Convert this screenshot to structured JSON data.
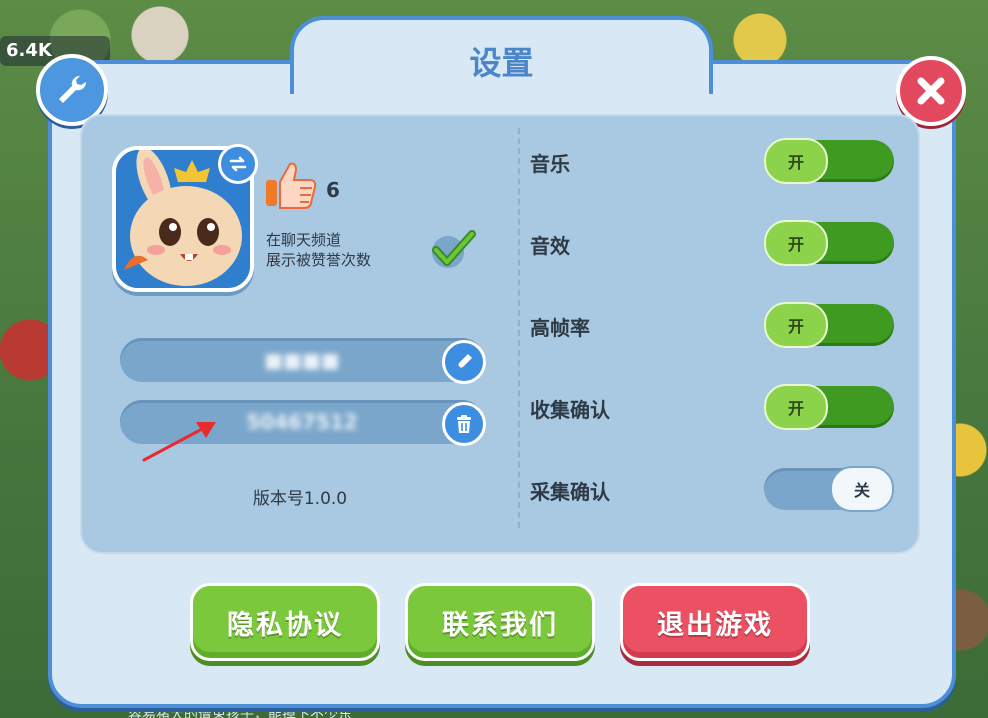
{
  "background": {
    "stat_badge": "6.4K",
    "bottom_text": "容易猪大的遭束孩子，能掉下不少东"
  },
  "dialog": {
    "title": "设置"
  },
  "profile": {
    "likes": "6",
    "chat_display_line1": "在聊天频道",
    "chat_display_line2": "展示被赞誉次数",
    "chat_display_enabled": true,
    "name_value": "■■■■",
    "id_value": "50467512",
    "version": "版本号1.0.0"
  },
  "settings": [
    {
      "label": "音乐",
      "state": "开",
      "on": true
    },
    {
      "label": "音效",
      "state": "开",
      "on": true
    },
    {
      "label": "高帧率",
      "state": "开",
      "on": true
    },
    {
      "label": "收集确认",
      "state": "开",
      "on": true
    },
    {
      "label": "采集确认",
      "state": "关",
      "on": false
    }
  ],
  "buttons": {
    "privacy": "隐私协议",
    "contact": "联系我们",
    "exit": "退出游戏"
  },
  "colors": {
    "accent_blue": "#4c8fd6",
    "toggle_on": "#3f9a22",
    "button_green": "#7cc83c",
    "button_red": "#ec5063"
  },
  "icons": {
    "wrench": "wrench-icon",
    "close": "close-icon",
    "swap": "swap-icon",
    "edit": "pencil-icon",
    "delete": "trash-icon",
    "like": "thumbs-up-icon",
    "check": "check-icon"
  }
}
